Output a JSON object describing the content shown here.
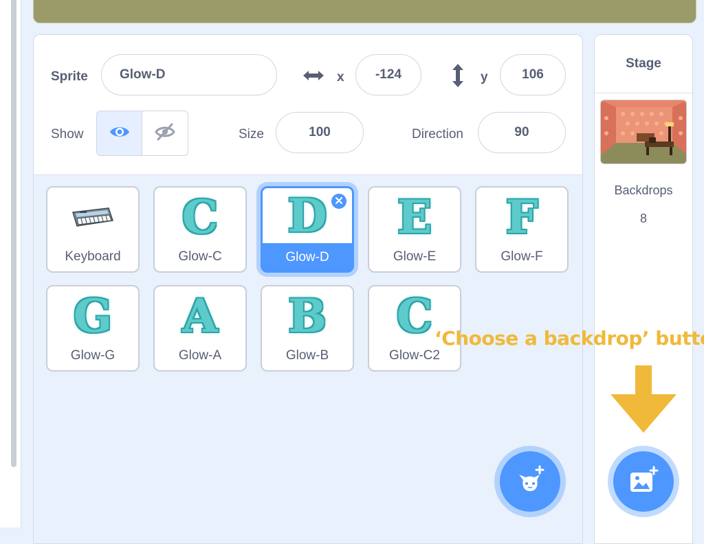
{
  "sprite_info": {
    "sprite_label": "Sprite",
    "sprite_name": "Glow-D",
    "x_label": "x",
    "x_value": "-124",
    "y_label": "y",
    "y_value": "106",
    "show_label": "Show",
    "size_label": "Size",
    "size_value": "100",
    "direction_label": "Direction",
    "direction_value": "90"
  },
  "sprites": [
    {
      "name": "Keyboard",
      "thumb": "keyboard-image"
    },
    {
      "name": "Glow-C",
      "letter": "C"
    },
    {
      "name": "Glow-D",
      "letter": "D",
      "selected": true
    },
    {
      "name": "Glow-E",
      "letter": "E"
    },
    {
      "name": "Glow-F",
      "letter": "F"
    },
    {
      "name": "Glow-G",
      "letter": "G"
    },
    {
      "name": "Glow-A",
      "letter": "A"
    },
    {
      "name": "Glow-B",
      "letter": "B"
    },
    {
      "name": "Glow-C2",
      "letter": "C"
    }
  ],
  "stage": {
    "title": "Stage",
    "backdrops_label": "Backdrops",
    "backdrops_count": "8"
  },
  "annotation": {
    "text": "‘Choose a backdrop’ button"
  },
  "icons": {
    "x_icon": "horizontal-arrows-icon",
    "y_icon": "vertical-arrows-icon",
    "show_visible": "eye-icon",
    "show_hidden": "eye-slash-icon",
    "delete": "close-icon",
    "choose_sprite": "cat-plus-icon",
    "choose_backdrop": "image-plus-icon"
  },
  "colors": {
    "accent": "#4d97ff",
    "glow_letter": "#5dcbcb",
    "annotation": "#f0b93a",
    "stage_strip": "#9b9b6a"
  }
}
